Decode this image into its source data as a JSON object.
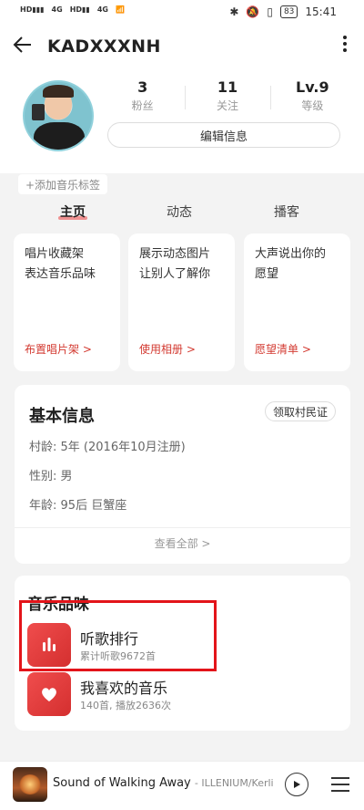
{
  "status": {
    "time": "15:41",
    "battery": "83",
    "net1": "4G",
    "net2": "4G"
  },
  "header": {
    "back_icon": "arrow-left-icon",
    "title": "KADXXXNH",
    "more_icon": "more-vertical-icon"
  },
  "profile": {
    "stats": [
      {
        "value": "3",
        "label": "粉丝"
      },
      {
        "value": "11",
        "label": "关注"
      },
      {
        "value": "Lv.9",
        "label": "等级"
      }
    ],
    "edit_label": "编辑信息"
  },
  "tag_button": "+添加音乐标签",
  "tabs": [
    "主页",
    "动态",
    "播客"
  ],
  "cards": [
    {
      "desc1": "唱片收藏架",
      "desc2": "表达音乐品味",
      "link": "布置唱片架 >"
    },
    {
      "desc1": "展示动态图片",
      "desc2": "让别人了解你",
      "link": "使用相册 >"
    },
    {
      "desc1": "大声说出你的",
      "desc2": "愿望",
      "link": "愿望清单 >"
    }
  ],
  "basic_info": {
    "title": "基本信息",
    "badge": "领取村民证",
    "rows": [
      {
        "label": "村龄:",
        "value": "5年 (2016年10月注册)"
      },
      {
        "label": "性别:",
        "value": "男"
      },
      {
        "label": "年龄:",
        "value": "95后 巨蟹座"
      }
    ],
    "view_all": "查看全部 >"
  },
  "music_taste": {
    "title": "音乐品味",
    "items": [
      {
        "title": "听歌排行",
        "sub": "累计听歌9672首",
        "icon": "chart-bars-icon"
      },
      {
        "title": "我喜欢的音乐",
        "sub": "140首, 播放2636次",
        "icon": "heart-icon"
      }
    ]
  },
  "player": {
    "song": "Sound of Walking Away",
    "artist": "- ILLENIUM/Kerli"
  },
  "colors": {
    "accent": "#d33a31",
    "highlight_box": "#e3141a"
  }
}
